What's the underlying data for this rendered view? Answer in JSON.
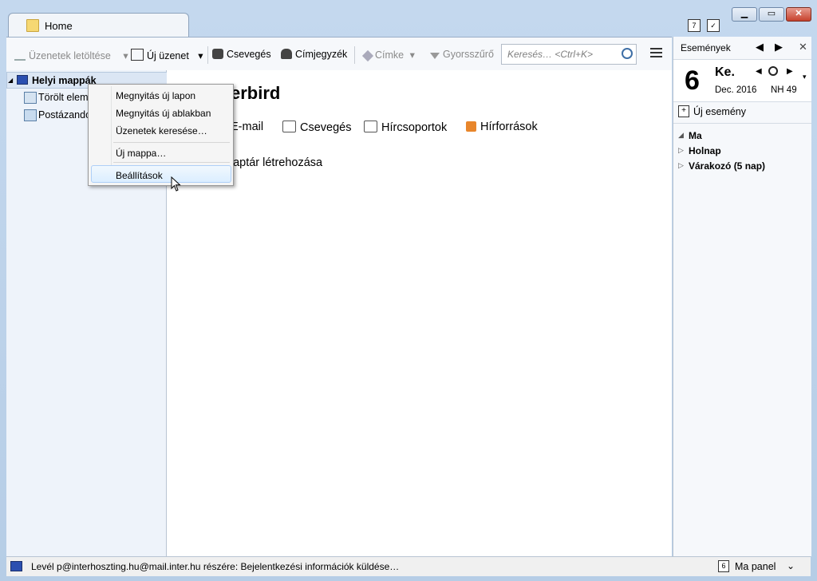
{
  "tab": {
    "label": "Home"
  },
  "toolbar": {
    "get_messages": "Üzenetek letöltése",
    "write": "Új üzenet",
    "chat": "Csevegés",
    "address_book": "Címjegyzék",
    "tag": "Címke",
    "quick_filter": "Gyorsszűrő",
    "search_placeholder": "Keresés… <Ctrl+K>"
  },
  "folders": {
    "root": "Helyi mappák",
    "trash": "Törölt elem",
    "outbox": "Postázandó"
  },
  "main": {
    "title": "erbird",
    "accounts": [
      {
        "label": "E-mail"
      },
      {
        "label": "Csevegés"
      },
      {
        "label": "Hírcsoportok"
      },
      {
        "label": "Hírforrások"
      }
    ],
    "calendar_create": "naptár létrehozása"
  },
  "context_menu": {
    "items": [
      "Megnyitás új lapon",
      "Megnyitás új ablakban",
      "Üzenetek keresése…",
      "Új mappa…",
      "Beállítások"
    ]
  },
  "today_pane": {
    "title": "Események",
    "day": "6",
    "weekday": "Ke.",
    "month_year": "Dec. 2016",
    "week": "NH 49",
    "new_event": "Új esemény",
    "groups": [
      "Ma",
      "Holnap",
      "Várakozó (5 nap)"
    ]
  },
  "status": {
    "text": "Levél p@interhoszting.hu@mail.inter.hu részére: Bejelentkezési információk küldése…",
    "panel_label": "Ma panel",
    "panel_day": "6"
  },
  "colors": {
    "accent": "#3f6fa6",
    "selection": "#dbe6f4",
    "rss": "#e8862b"
  }
}
